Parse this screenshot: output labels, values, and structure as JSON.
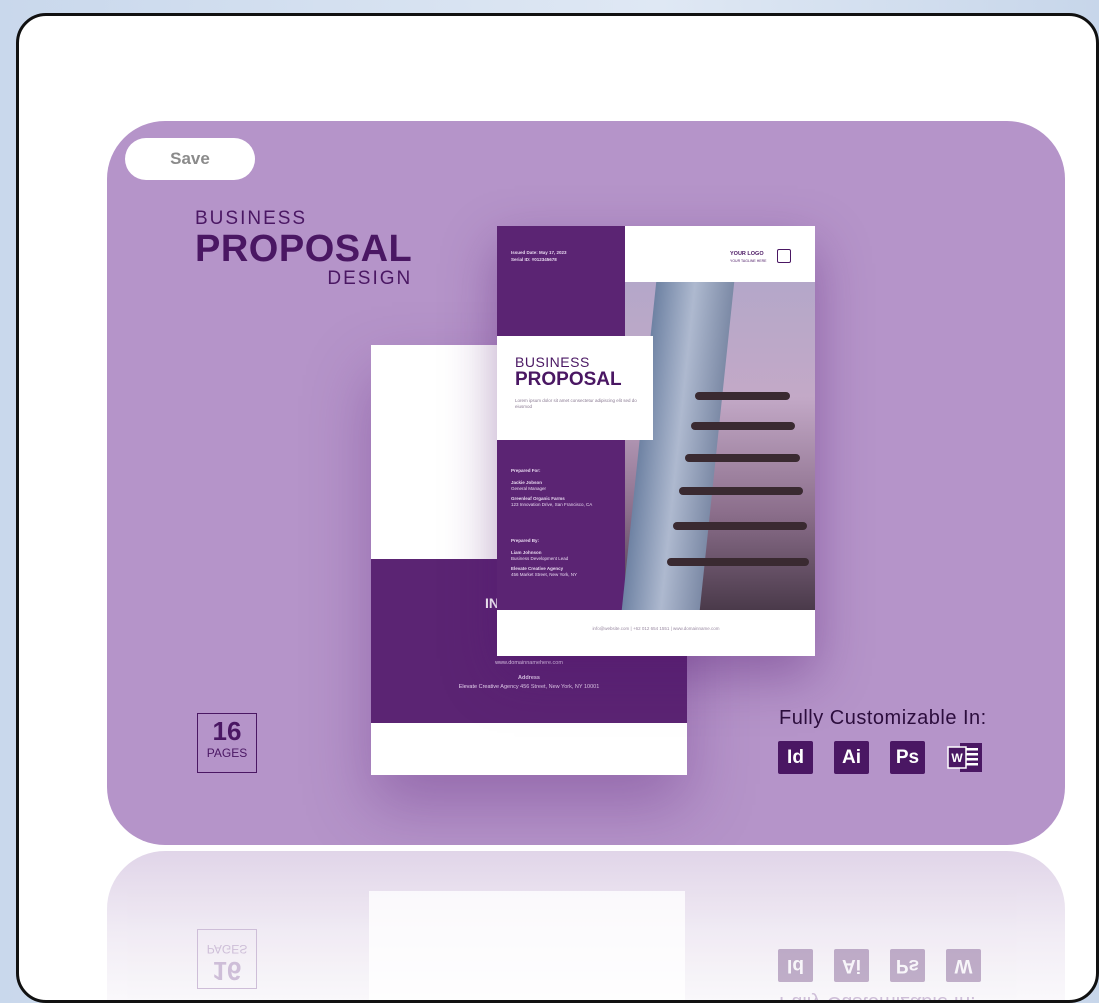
{
  "save_label": "Save",
  "heading": {
    "line1": "BUSINESS",
    "line2": "PROPOSAL",
    "line3": "DESIGN"
  },
  "pages": {
    "count": "16",
    "label": "PAGES"
  },
  "customizable": {
    "label": "Fully Customizable In:",
    "apps": [
      "Id",
      "Ai",
      "Ps",
      "W"
    ]
  },
  "reflection": {
    "pages": "16",
    "pages_label": "PAGES",
    "customizable": "Fully Customizable In:"
  },
  "brochure_front": {
    "issued": "Issued Date: May 17, 2023",
    "serial": "Serial ID:     #012345678",
    "logo": "YOUR LOGO",
    "logo_sub": "YOUR TAGLINE HERE",
    "title1": "BUSINESS",
    "title2": "PROPOSAL",
    "desc": "Lorem ipsum dolor sit amet consectetur adipiscing elit sed do eiusmod",
    "prepared_for": "Prepared For:",
    "pf_name": "Jackie Jobson",
    "pf_role": "General Manager",
    "pf_company": "Greenleaf Organic Farms",
    "pf_addr": "123 Innovation Drive, San Francisco, CA",
    "prepared_by": "Prepared By:",
    "pb_name": "Liam Johnson",
    "pb_role": "Business Development Lead",
    "pb_company": "Elevate Creative Agency",
    "pb_addr": "456 Market Street, New York, NY",
    "footer": "info@website.com | +62 012 654 1551 | www.domainname.com"
  },
  "brochure_back": {
    "in_label": "IN",
    "website_label": "Website",
    "website": "www.domainnamehere.com",
    "address_label": "Address",
    "address": "Elevate Creative Agency 456 Street, New York, NY 10001"
  },
  "colors": {
    "card": "#b594c9",
    "accent": "#4a1763",
    "band": "#5b2473"
  }
}
